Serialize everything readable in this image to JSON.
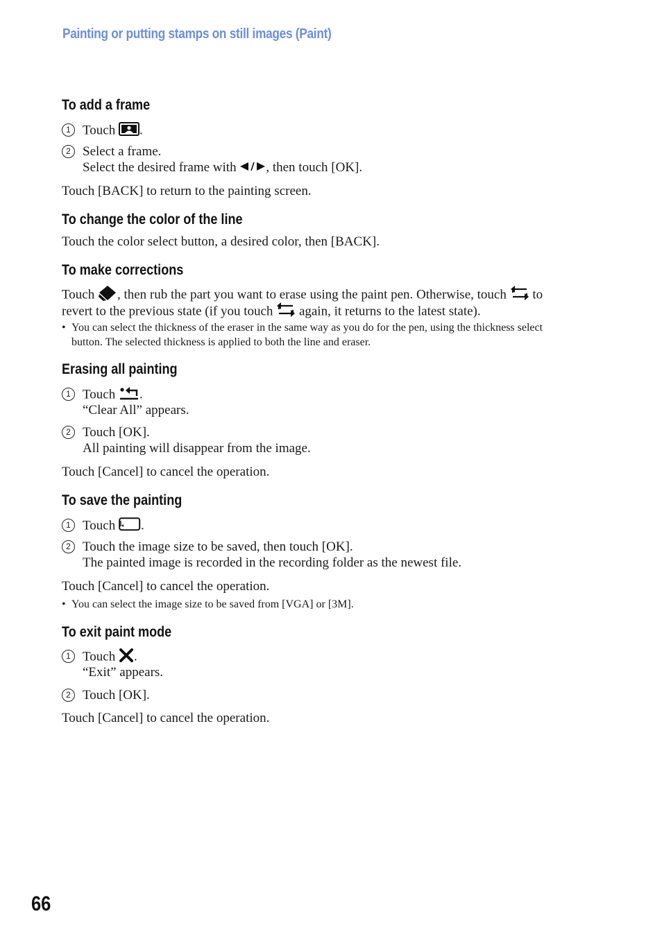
{
  "running_head": "Painting or putting stamps on still images (Paint)",
  "colors": {
    "running_head": "#6e8fd6",
    "text": "#1a1a1a"
  },
  "sections": {
    "add_frame": {
      "heading": "To add a frame",
      "steps": [
        {
          "num": "1",
          "text_before": "Touch",
          "icon": "frame-icon",
          "text_after": "."
        },
        {
          "num": "2",
          "text": "Select a frame.",
          "sub_before": "Select the desired frame with ",
          "sub_icon": "left-right-arrows",
          "sub_after": ", then touch [OK]."
        }
      ],
      "after": "Touch [BACK] to return to the painting screen."
    },
    "change_color": {
      "heading": "To change the color of the line",
      "body": "Touch the color select button, a desired color, then [BACK]."
    },
    "corrections": {
      "heading": "To make corrections",
      "line1_a": "Touch ",
      "line1_b": ", then rub the part you want to erase using the paint pen. Otherwise, touch ",
      "line1_c": " to",
      "line2_a": "revert to the previous state (if you touch ",
      "line2_b": " again, it returns to the latest state).",
      "note_line1": "You can select the thickness of the eraser in the same way as you do for the pen, using the thickness select",
      "note_line2": "button. The selected thickness is applied to both the line and eraser.",
      "icons": [
        "eraser-icon",
        "undo-redo-icon"
      ]
    },
    "erase_all": {
      "heading": "Erasing all painting",
      "steps": [
        {
          "num": "1",
          "text_before": "Touch",
          "icon": "clear-all-icon",
          "text_after": ".",
          "sub": "“Clear All” appears."
        },
        {
          "num": "2",
          "text": "Touch [OK].",
          "sub": "All painting will disappear from the image."
        }
      ],
      "after": "Touch [Cancel] to cancel the operation."
    },
    "save": {
      "heading": "To save the painting",
      "steps": [
        {
          "num": "1",
          "text_before": "Touch",
          "icon": "save-icon",
          "text_after": "."
        },
        {
          "num": "2",
          "text": "Touch the image size to be saved, then touch [OK].",
          "sub": "The painted image is recorded in the recording folder as the newest file."
        }
      ],
      "after": "Touch [Cancel] to cancel the operation.",
      "note": "You can select the image size to be saved from [VGA] or [3M]."
    },
    "exit": {
      "heading": "To exit paint mode",
      "steps": [
        {
          "num": "1",
          "text_before": "Touch",
          "icon": "close-icon",
          "text_after": ".",
          "sub": "“Exit” appears."
        },
        {
          "num": "2",
          "text": "Touch [OK]."
        }
      ],
      "after": "Touch [Cancel] to cancel the operation."
    }
  },
  "bullet": "•",
  "page_number": "66"
}
